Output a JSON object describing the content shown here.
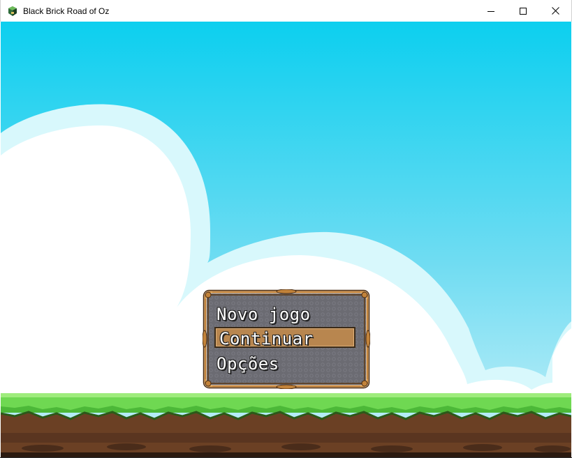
{
  "window": {
    "title": "Black Brick Road of Oz",
    "controls": {
      "minimize": "minimize-icon",
      "maximize": "maximize-icon",
      "close": "close-icon"
    }
  },
  "menu": {
    "items": [
      {
        "label": "Novo jogo",
        "selected": false
      },
      {
        "label": "Continuar",
        "selected": true
      },
      {
        "label": "Opções",
        "selected": false
      }
    ]
  },
  "colors": {
    "sky_top": "#0ccfef",
    "sky_bottom": "#b8ecf6",
    "cloud": "#ffffff",
    "cloud_halo": "#d8f8fc",
    "grass": "#6fd852",
    "dirt": "#6b4024",
    "menu_bg": "#6b6b72",
    "menu_border": "#c2833b",
    "selection": "#b8864f"
  }
}
